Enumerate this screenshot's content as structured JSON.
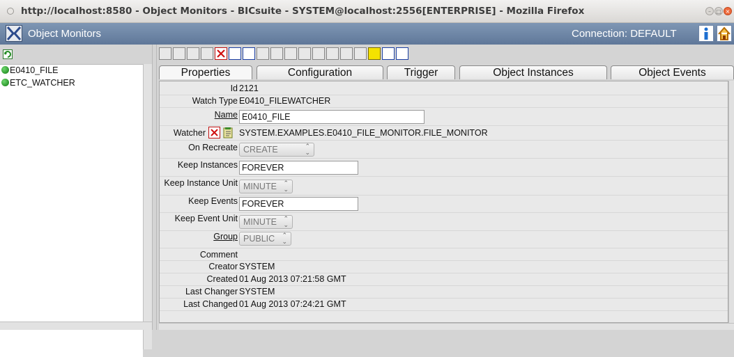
{
  "window": {
    "title": "http://localhost:8580 - Object Monitors - BICsuite - SYSTEM@localhost:2556[ENTERPRISE] - Mozilla Firefox"
  },
  "app": {
    "title": "Object Monitors",
    "connection": "Connection: DEFAULT"
  },
  "tree": {
    "items": [
      {
        "label": "E0410_FILE"
      },
      {
        "label": "ETC_WATCHER"
      }
    ]
  },
  "tabs": [
    {
      "label": "Properties"
    },
    {
      "label": "Configuration"
    },
    {
      "label": "Trigger"
    },
    {
      "label": "Object Instances"
    },
    {
      "label": "Object Events"
    }
  ],
  "form": {
    "id": {
      "label": "Id",
      "value": "2121"
    },
    "watch_type": {
      "label": "Watch Type",
      "value": "E0410_FILEWATCHER"
    },
    "name": {
      "label": "Name",
      "value": "E0410_FILE"
    },
    "watcher": {
      "label": "Watcher",
      "value": "SYSTEM.EXAMPLES.E0410_FILE_MONITOR.FILE_MONITOR"
    },
    "on_recreate": {
      "label": "On Recreate",
      "value": "CREATE"
    },
    "keep_instances": {
      "label": "Keep Instances",
      "value": "FOREVER"
    },
    "keep_instance_unit": {
      "label": "Keep Instance Unit",
      "value": "MINUTE"
    },
    "keep_events": {
      "label": "Keep Events",
      "value": "FOREVER"
    },
    "keep_event_unit": {
      "label": "Keep Event Unit",
      "value": "MINUTE"
    },
    "group": {
      "label": "Group",
      "value": "PUBLIC"
    },
    "comment": {
      "label": "Comment",
      "value": ""
    },
    "creator": {
      "label": "Creator",
      "value": "SYSTEM"
    },
    "created": {
      "label": "Created",
      "value": "01 Aug 2013 07:21:58 GMT"
    },
    "last_changer": {
      "label": "Last Changer",
      "value": "SYSTEM"
    },
    "last_changed": {
      "label": "Last Changed",
      "value": "01 Aug 2013 07:24:21 GMT"
    }
  },
  "icons": {
    "toolbar": [
      "refresh-icon",
      "back-icon",
      "save-icon",
      "copy-icon",
      "delete-icon",
      "new-icon",
      "xy-icon",
      "minus-icon",
      "plus-icon",
      "grid-icon",
      "grid-icon",
      "grid-icon",
      "cut-icon",
      "paste-icon",
      "clipboard-icon",
      "key-icon",
      "comment-icon",
      "download-icon"
    ]
  }
}
